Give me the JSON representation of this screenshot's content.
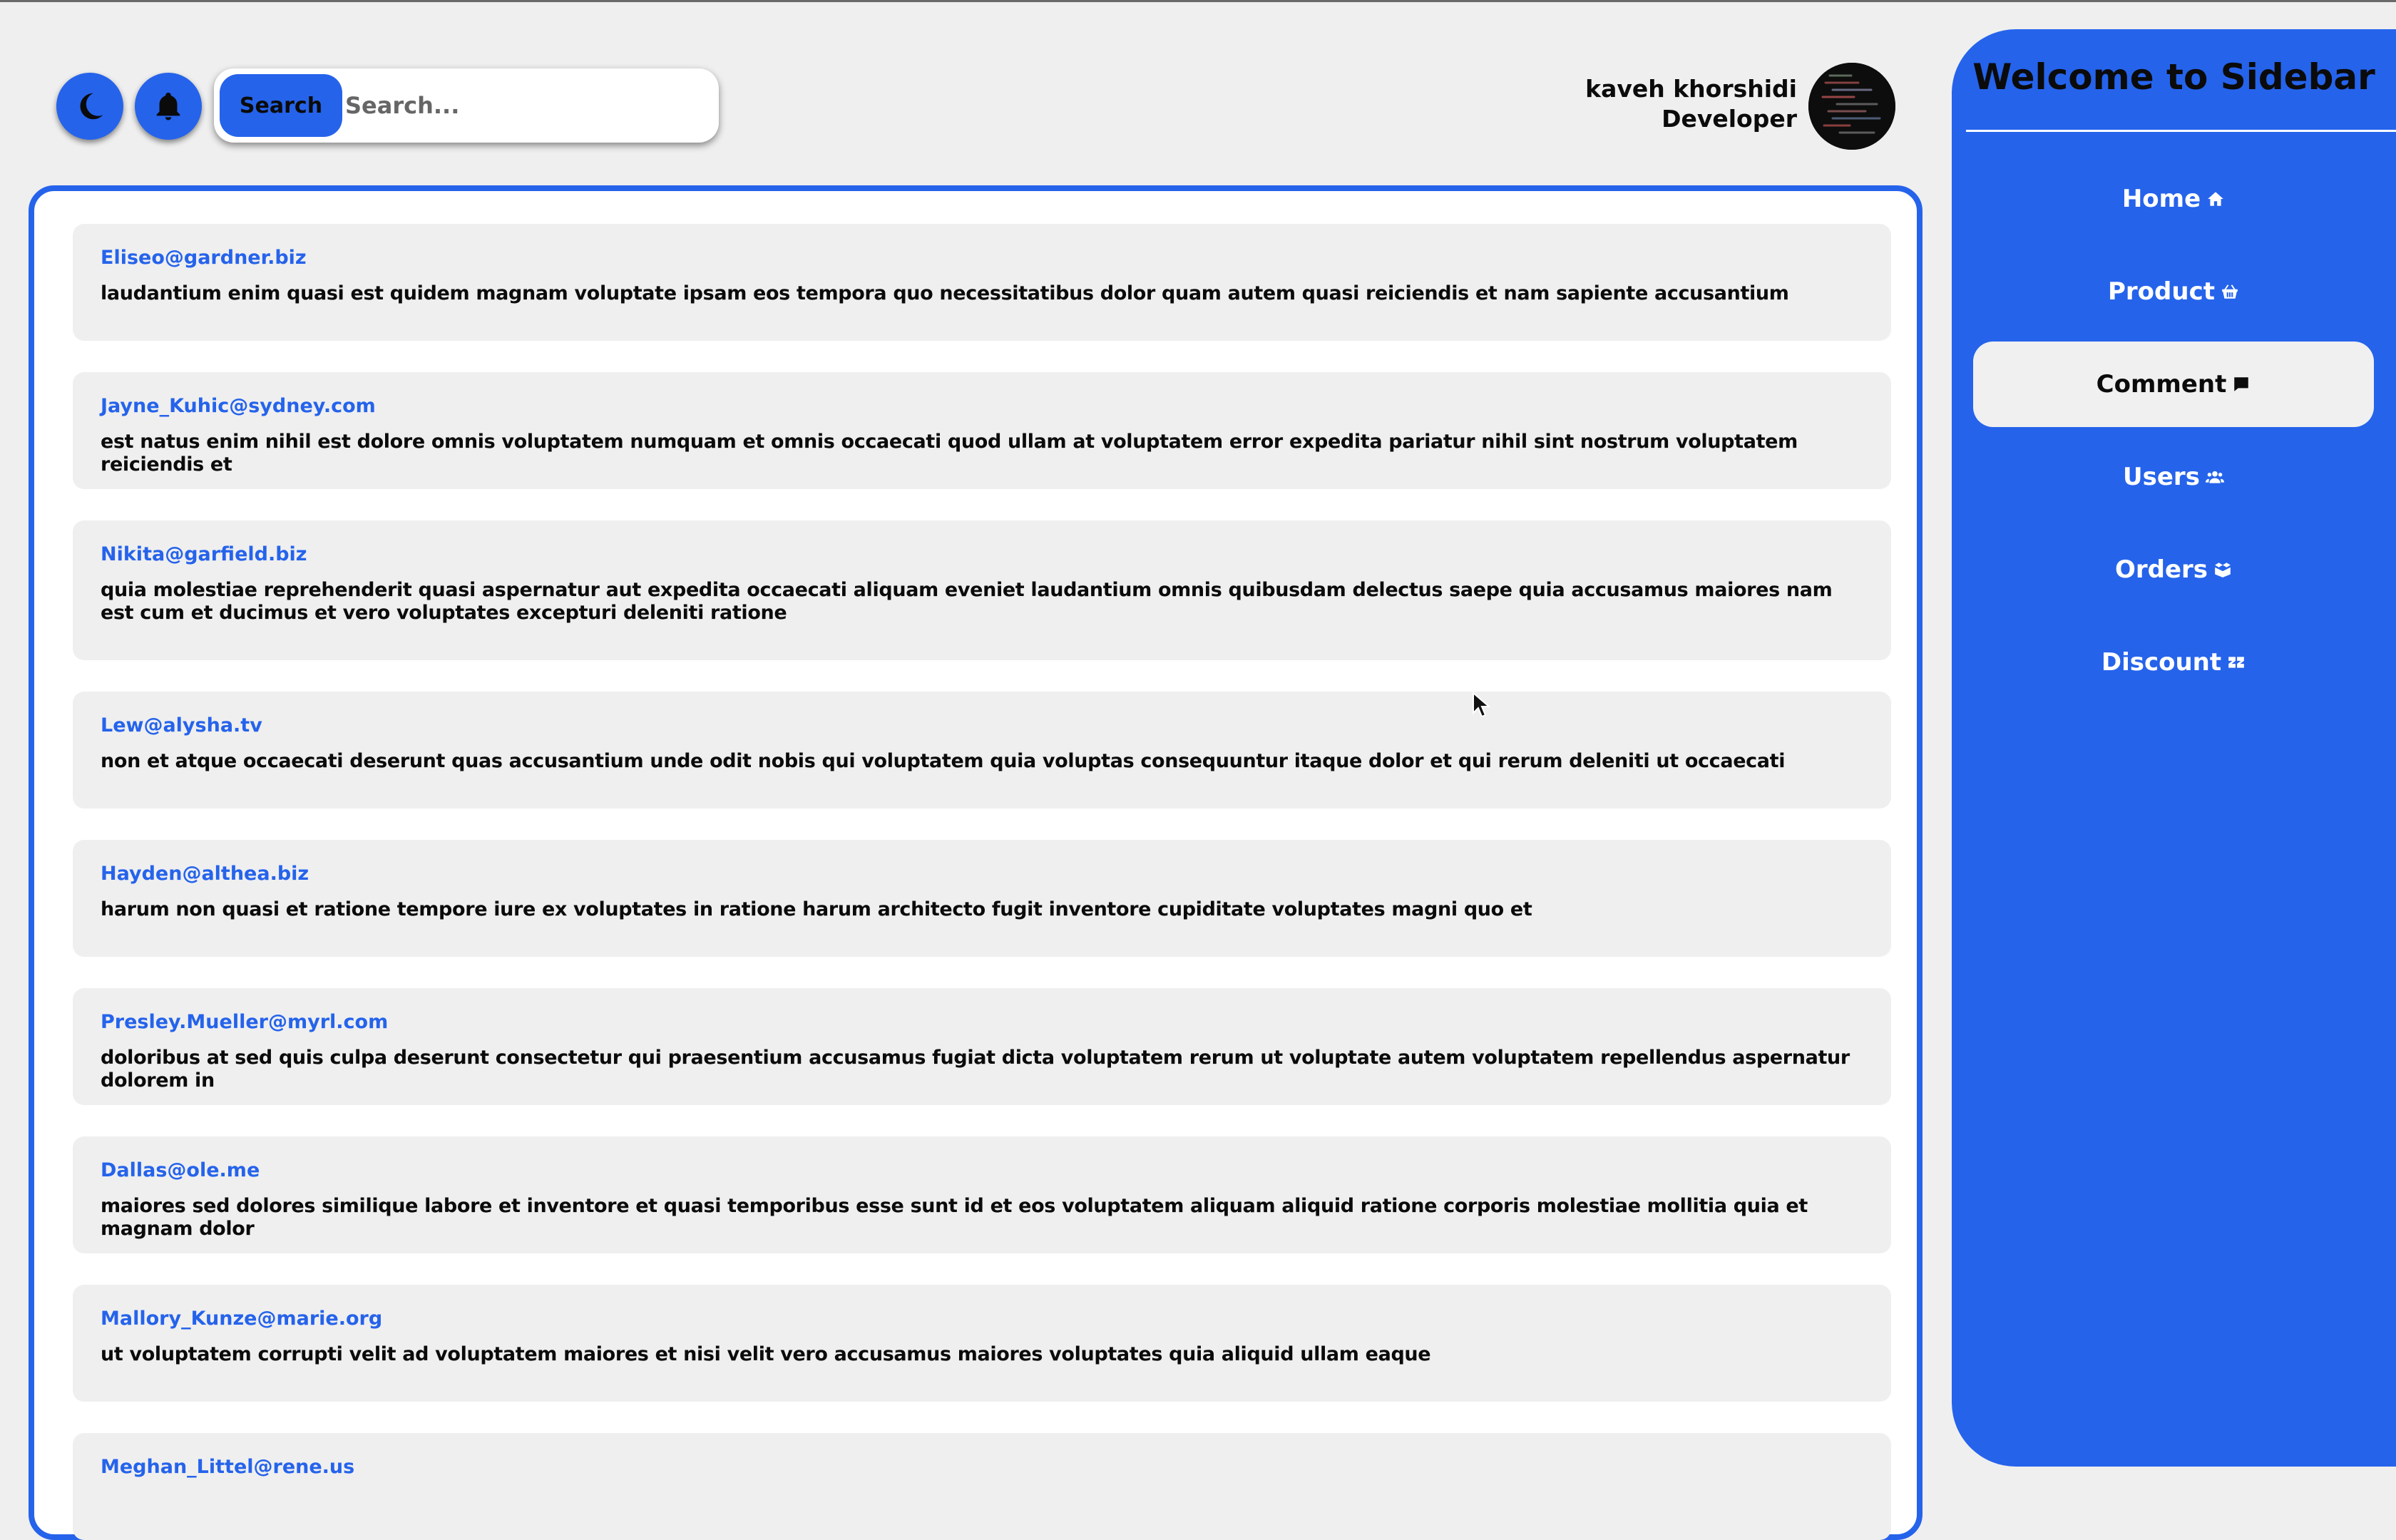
{
  "header": {
    "theme_toggle_icon": "moon-icon",
    "notification_icon": "bell-icon",
    "search": {
      "button_label": "Search",
      "placeholder": "Search...",
      "value": ""
    },
    "user": {
      "name": "kaveh khorshidi",
      "role": "Developer",
      "avatar_icon": "code-screenshot-avatar"
    }
  },
  "comments": [
    {
      "email": "Eliseo@gardner.biz",
      "body": "laudantium enim quasi est quidem magnam voluptate ipsam eos tempora quo necessitatibus dolor quam autem quasi reiciendis et nam sapiente accusantium"
    },
    {
      "email": "Jayne_Kuhic@sydney.com",
      "body": "est natus enim nihil est dolore omnis voluptatem numquam et omnis occaecati quod ullam at voluptatem error expedita pariatur nihil sint nostrum voluptatem reiciendis et"
    },
    {
      "email": "Nikita@garfield.biz",
      "body": "quia molestiae reprehenderit quasi aspernatur aut expedita occaecati aliquam eveniet laudantium omnis quibusdam delectus saepe quia accusamus maiores nam est cum et ducimus et vero voluptates excepturi deleniti ratione"
    },
    {
      "email": "Lew@alysha.tv",
      "body": "non et atque occaecati deserunt quas accusantium unde odit nobis qui voluptatem quia voluptas consequuntur itaque dolor et qui rerum deleniti ut occaecati"
    },
    {
      "email": "Hayden@althea.biz",
      "body": "harum non quasi et ratione tempore iure ex voluptates in ratione harum architecto fugit inventore cupiditate voluptates magni quo et"
    },
    {
      "email": "Presley.Mueller@myrl.com",
      "body": "doloribus at sed quis culpa deserunt consectetur qui praesentium accusamus fugiat dicta voluptatem rerum ut voluptate autem voluptatem repellendus aspernatur dolorem in"
    },
    {
      "email": "Dallas@ole.me",
      "body": "maiores sed dolores similique labore et inventore et quasi temporibus esse sunt id et eos voluptatem aliquam aliquid ratione corporis molestiae mollitia quia et magnam dolor"
    },
    {
      "email": "Mallory_Kunze@marie.org",
      "body": "ut voluptatem corrupti velit ad voluptatem maiores et nisi velit vero accusamus maiores voluptates quia aliquid ullam eaque"
    },
    {
      "email": "Meghan_Littel@rene.us",
      "body": ""
    }
  ],
  "sidebar": {
    "title": "Welcome to Sidebar",
    "items": [
      {
        "label": "Home",
        "icon": "home-icon",
        "active": false
      },
      {
        "label": "Product",
        "icon": "basket-icon",
        "active": false
      },
      {
        "label": "Comment",
        "icon": "comment-icon",
        "active": true
      },
      {
        "label": "Users",
        "icon": "users-icon",
        "active": false
      },
      {
        "label": "Orders",
        "icon": "box-icon",
        "active": false
      },
      {
        "label": "Discount",
        "icon": "percent-icon",
        "active": false
      }
    ]
  },
  "colors": {
    "accent": "#2563eb",
    "background": "#efefef",
    "card": "#efefef",
    "text": "#0b0b0b"
  }
}
